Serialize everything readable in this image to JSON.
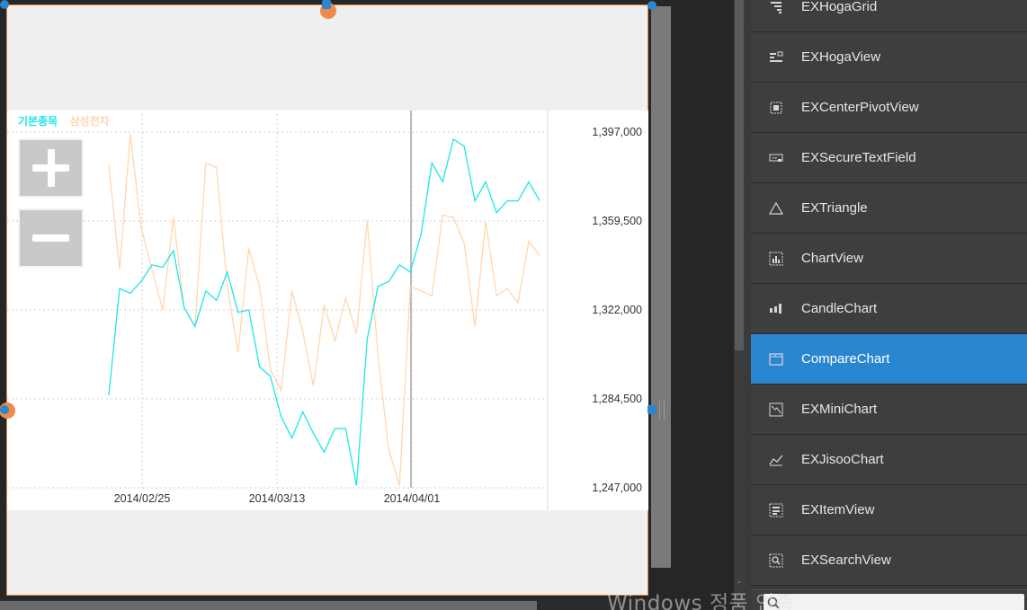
{
  "chart": {
    "legend": {
      "base_label": "기본종목",
      "base_color": "#1ee6e6",
      "compare_label": "삼성전자",
      "compare_color": "#ffd7b0"
    }
  },
  "chart_data": {
    "type": "line",
    "x_tick_labels": [
      "2014/02/25",
      "2014/03/13",
      "2014/04/01"
    ],
    "y_tick_labels": [
      "1,397,000",
      "1,359,500",
      "1,322,000",
      "1,284,500",
      "1,247,000"
    ],
    "ylim": [
      1247000,
      1397000
    ],
    "grid": true,
    "legend_position": "top-left",
    "series": [
      {
        "name": "기본종목",
        "color": "#1ee6e6",
        "values": [
          1286000,
          1331000,
          1329000,
          1334000,
          1341000,
          1340000,
          1347000,
          1323000,
          1315000,
          1330000,
          1326000,
          1338000,
          1321000,
          1322000,
          1298000,
          1294000,
          1277000,
          1268000,
          1279000,
          1270000,
          1262000,
          1272000,
          1272000,
          1248000,
          1310000,
          1332000,
          1334000,
          1341000,
          1338000,
          1354000,
          1384000,
          1376000,
          1394000,
          1391000,
          1368000,
          1376000,
          1363000,
          1368000,
          1368000,
          1376000,
          1368000
        ]
      },
      {
        "name": "삼성전자",
        "color": "#ffd7b0",
        "values": [
          1383000,
          1339000,
          1396000,
          1357000,
          1339000,
          1322000,
          1361000,
          1323000,
          1315000,
          1384000,
          1382000,
          1332000,
          1304000,
          1348000,
          1332000,
          1297000,
          1288000,
          1330000,
          1313000,
          1290000,
          1324000,
          1309000,
          1327000,
          1312000,
          1360000,
          1302000,
          1263000,
          1248000,
          1332000,
          1330000,
          1328000,
          1362000,
          1361000,
          1350000,
          1315000,
          1359000,
          1328000,
          1331000,
          1325000,
          1351000,
          1345000
        ]
      }
    ]
  },
  "components": [
    {
      "label": "EXHogaGrid",
      "icon": "hoga-grid-icon",
      "selected": false
    },
    {
      "label": "EXHogaView",
      "icon": "hoga-view-icon",
      "selected": false
    },
    {
      "label": "EXCenterPivotView",
      "icon": "pivot-view-icon",
      "selected": false
    },
    {
      "label": "EXSecureTextField",
      "icon": "secure-field-icon",
      "selected": false
    },
    {
      "label": "EXTriangle",
      "icon": "triangle-icon",
      "selected": false
    },
    {
      "label": "ChartView",
      "icon": "chart-view-icon",
      "selected": false
    },
    {
      "label": "CandleChart",
      "icon": "candle-chart-icon",
      "selected": false
    },
    {
      "label": "CompareChart",
      "icon": "compare-chart-icon",
      "selected": true
    },
    {
      "label": "EXMiniChart",
      "icon": "mini-chart-icon",
      "selected": false
    },
    {
      "label": "EXJisooChart",
      "icon": "jisoo-chart-icon",
      "selected": false
    },
    {
      "label": "EXItemView",
      "icon": "item-view-icon",
      "selected": false
    },
    {
      "label": "EXSearchView",
      "icon": "search-view-icon",
      "selected": false
    }
  ],
  "watermark": "Windows 정품 인증",
  "colors": {
    "selection": "#2b86d0",
    "handle_orange": "#f08a4b",
    "handle_blue": "#2b86d0"
  }
}
